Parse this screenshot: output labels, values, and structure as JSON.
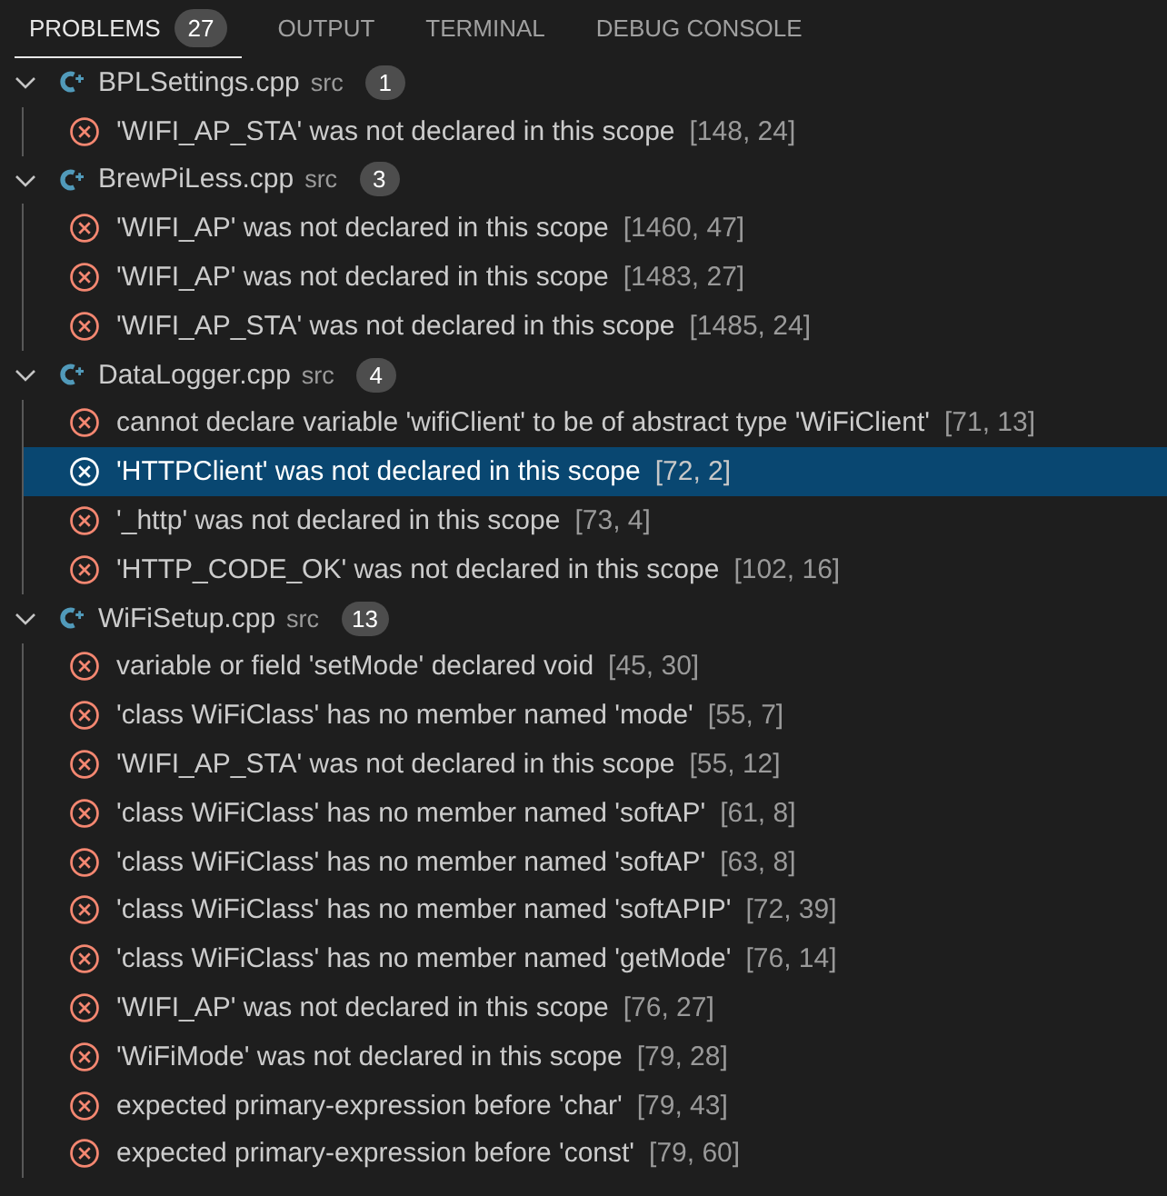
{
  "tabs": [
    {
      "label": "PROBLEMS",
      "badge": "27",
      "selected": true
    },
    {
      "label": "OUTPUT",
      "selected": false
    },
    {
      "label": "TERMINAL",
      "selected": false
    },
    {
      "label": "DEBUG CONSOLE",
      "selected": false
    }
  ],
  "files": [
    {
      "name": "BPLSettings.cpp",
      "folder": "src",
      "count": "1",
      "expanded": true,
      "problems": [
        {
          "message": "'WIFI_AP_STA' was not declared in this scope",
          "location": "[148, 24]",
          "selected": false
        }
      ]
    },
    {
      "name": "BrewPiLess.cpp",
      "folder": "src",
      "count": "3",
      "expanded": true,
      "problems": [
        {
          "message": "'WIFI_AP' was not declared in this scope",
          "location": "[1460, 47]",
          "selected": false
        },
        {
          "message": "'WIFI_AP' was not declared in this scope",
          "location": "[1483, 27]",
          "selected": false
        },
        {
          "message": "'WIFI_AP_STA' was not declared in this scope",
          "location": "[1485, 24]",
          "selected": false
        }
      ]
    },
    {
      "name": "DataLogger.cpp",
      "folder": "src",
      "count": "4",
      "expanded": true,
      "problems": [
        {
          "message": "cannot declare variable 'wifiClient' to be of abstract type 'WiFiClient'",
          "location": "[71, 13]",
          "selected": false
        },
        {
          "message": "'HTTPClient' was not declared in this scope",
          "location": "[72, 2]",
          "selected": true
        },
        {
          "message": "'_http' was not declared in this scope",
          "location": "[73, 4]",
          "selected": false
        },
        {
          "message": "'HTTP_CODE_OK' was not declared in this scope",
          "location": "[102, 16]",
          "selected": false
        }
      ]
    },
    {
      "name": "WiFiSetup.cpp",
      "folder": "src",
      "count": "13",
      "expanded": true,
      "problems": [
        {
          "message": "variable or field 'setMode' declared void",
          "location": "[45, 30]",
          "selected": false
        },
        {
          "message": "'class WiFiClass' has no member named 'mode'",
          "location": "[55, 7]",
          "selected": false
        },
        {
          "message": "'WIFI_AP_STA' was not declared in this scope",
          "location": "[55, 12]",
          "selected": false
        },
        {
          "message": "'class WiFiClass' has no member named 'softAP'",
          "location": "[61, 8]",
          "selected": false
        },
        {
          "message": "'class WiFiClass' has no member named 'softAP'",
          "location": "[63, 8]",
          "selected": false
        },
        {
          "message": "'class WiFiClass' has no member named 'softAPIP'",
          "location": "[72, 39]",
          "selected": false
        },
        {
          "message": "'class WiFiClass' has no member named 'getMode'",
          "location": "[76, 14]",
          "selected": false
        },
        {
          "message": "'WIFI_AP' was not declared in this scope",
          "location": "[76, 27]",
          "selected": false
        },
        {
          "message": "'WiFiMode' was not declared in this scope",
          "location": "[79, 28]",
          "selected": false
        },
        {
          "message": "expected primary-expression before 'char'",
          "location": "[79, 43]",
          "selected": false
        },
        {
          "message": "expected primary-expression before 'const'",
          "location": "[79, 60]",
          "selected": false
        }
      ]
    }
  ]
}
